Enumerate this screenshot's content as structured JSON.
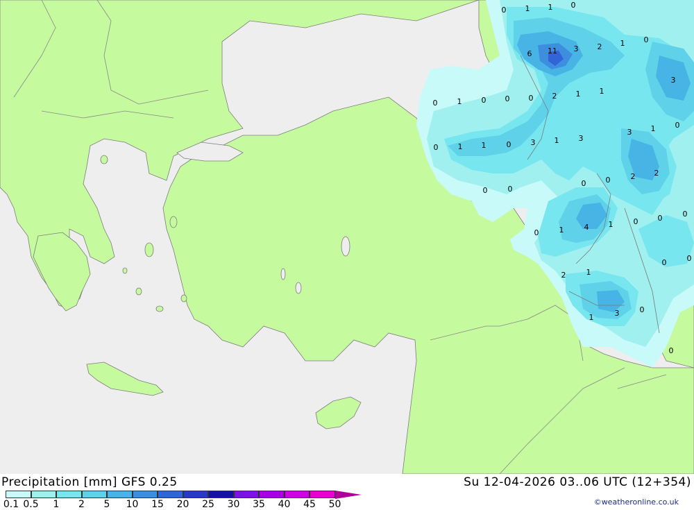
{
  "header": {
    "title": "Precipitation [mm] GFS 0.25",
    "datetime": "Su 12-04-2026 03..06 UTC (12+354)"
  },
  "legend": {
    "labels": [
      "0.1",
      "0.5",
      "1",
      "2",
      "5",
      "10",
      "15",
      "20",
      "25",
      "30",
      "35",
      "40",
      "45",
      "50"
    ],
    "colors": [
      "#c8fafa",
      "#a0f0f0",
      "#78e6ef",
      "#5fd2ea",
      "#48b4e6",
      "#3e8ee0",
      "#3264d8",
      "#2838c8",
      "#1410a8",
      "#7a14e6",
      "#a800e6",
      "#d200e6",
      "#e600d2",
      "#b0009b"
    ]
  },
  "map_colors": {
    "sea": "#eeeeee",
    "land": "#c6fa9e",
    "border": "#888888"
  },
  "map_values": [
    "0",
    "1",
    "1",
    "0",
    "6",
    "11",
    "3",
    "2",
    "1",
    "0",
    "3",
    "0",
    "1",
    "0",
    "0",
    "0",
    "2",
    "1",
    "1",
    "3",
    "1",
    "0",
    "1",
    "1",
    "0",
    "3",
    "1",
    "0",
    "3",
    "2",
    "2",
    "0",
    "0",
    "0",
    "0",
    "0",
    "1",
    "4",
    "1",
    "0",
    "0",
    "0",
    "0",
    "0",
    "2",
    "1",
    "1",
    "3",
    "0",
    "0"
  ],
  "credit": "©weatheronline.co.uk"
}
